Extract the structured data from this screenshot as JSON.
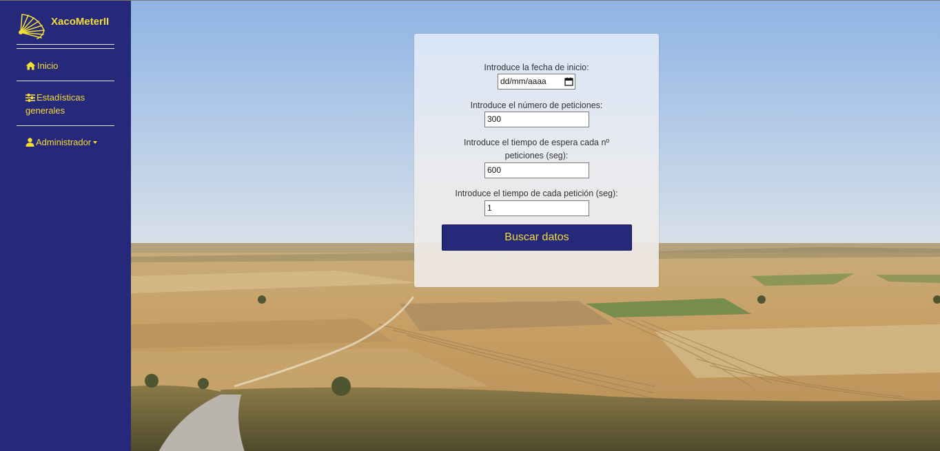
{
  "brand": {
    "name": "XacoMeterII",
    "logo_icon": "scallop-shell-icon"
  },
  "sidebar": {
    "items": [
      {
        "label": "Inicio",
        "icon": "home-icon"
      },
      {
        "label": "Estadísticas generales",
        "line1": "Estadísticas",
        "line2": "generales",
        "icon": "sliders-icon"
      },
      {
        "label": "Administrador",
        "icon": "user-icon",
        "dropdown": true
      }
    ]
  },
  "form": {
    "start_date": {
      "label": "Introduce la fecha de inicio:",
      "value": "dd/mm/aaaa"
    },
    "num_requests": {
      "label": "Introduce el número de peticiones:",
      "value": "300"
    },
    "wait_time": {
      "label_line1": "Introduce el tiempo de espera cada nº",
      "label_line2": "peticiones (seg):",
      "value": "600"
    },
    "request_time": {
      "label": "Introduce el tiempo de cada petición (seg):",
      "value": "1"
    },
    "submit_label": "Buscar datos"
  },
  "colors": {
    "sidebar_bg": "#262879",
    "accent_yellow": "#f3dd37",
    "button_bg": "#262879"
  }
}
